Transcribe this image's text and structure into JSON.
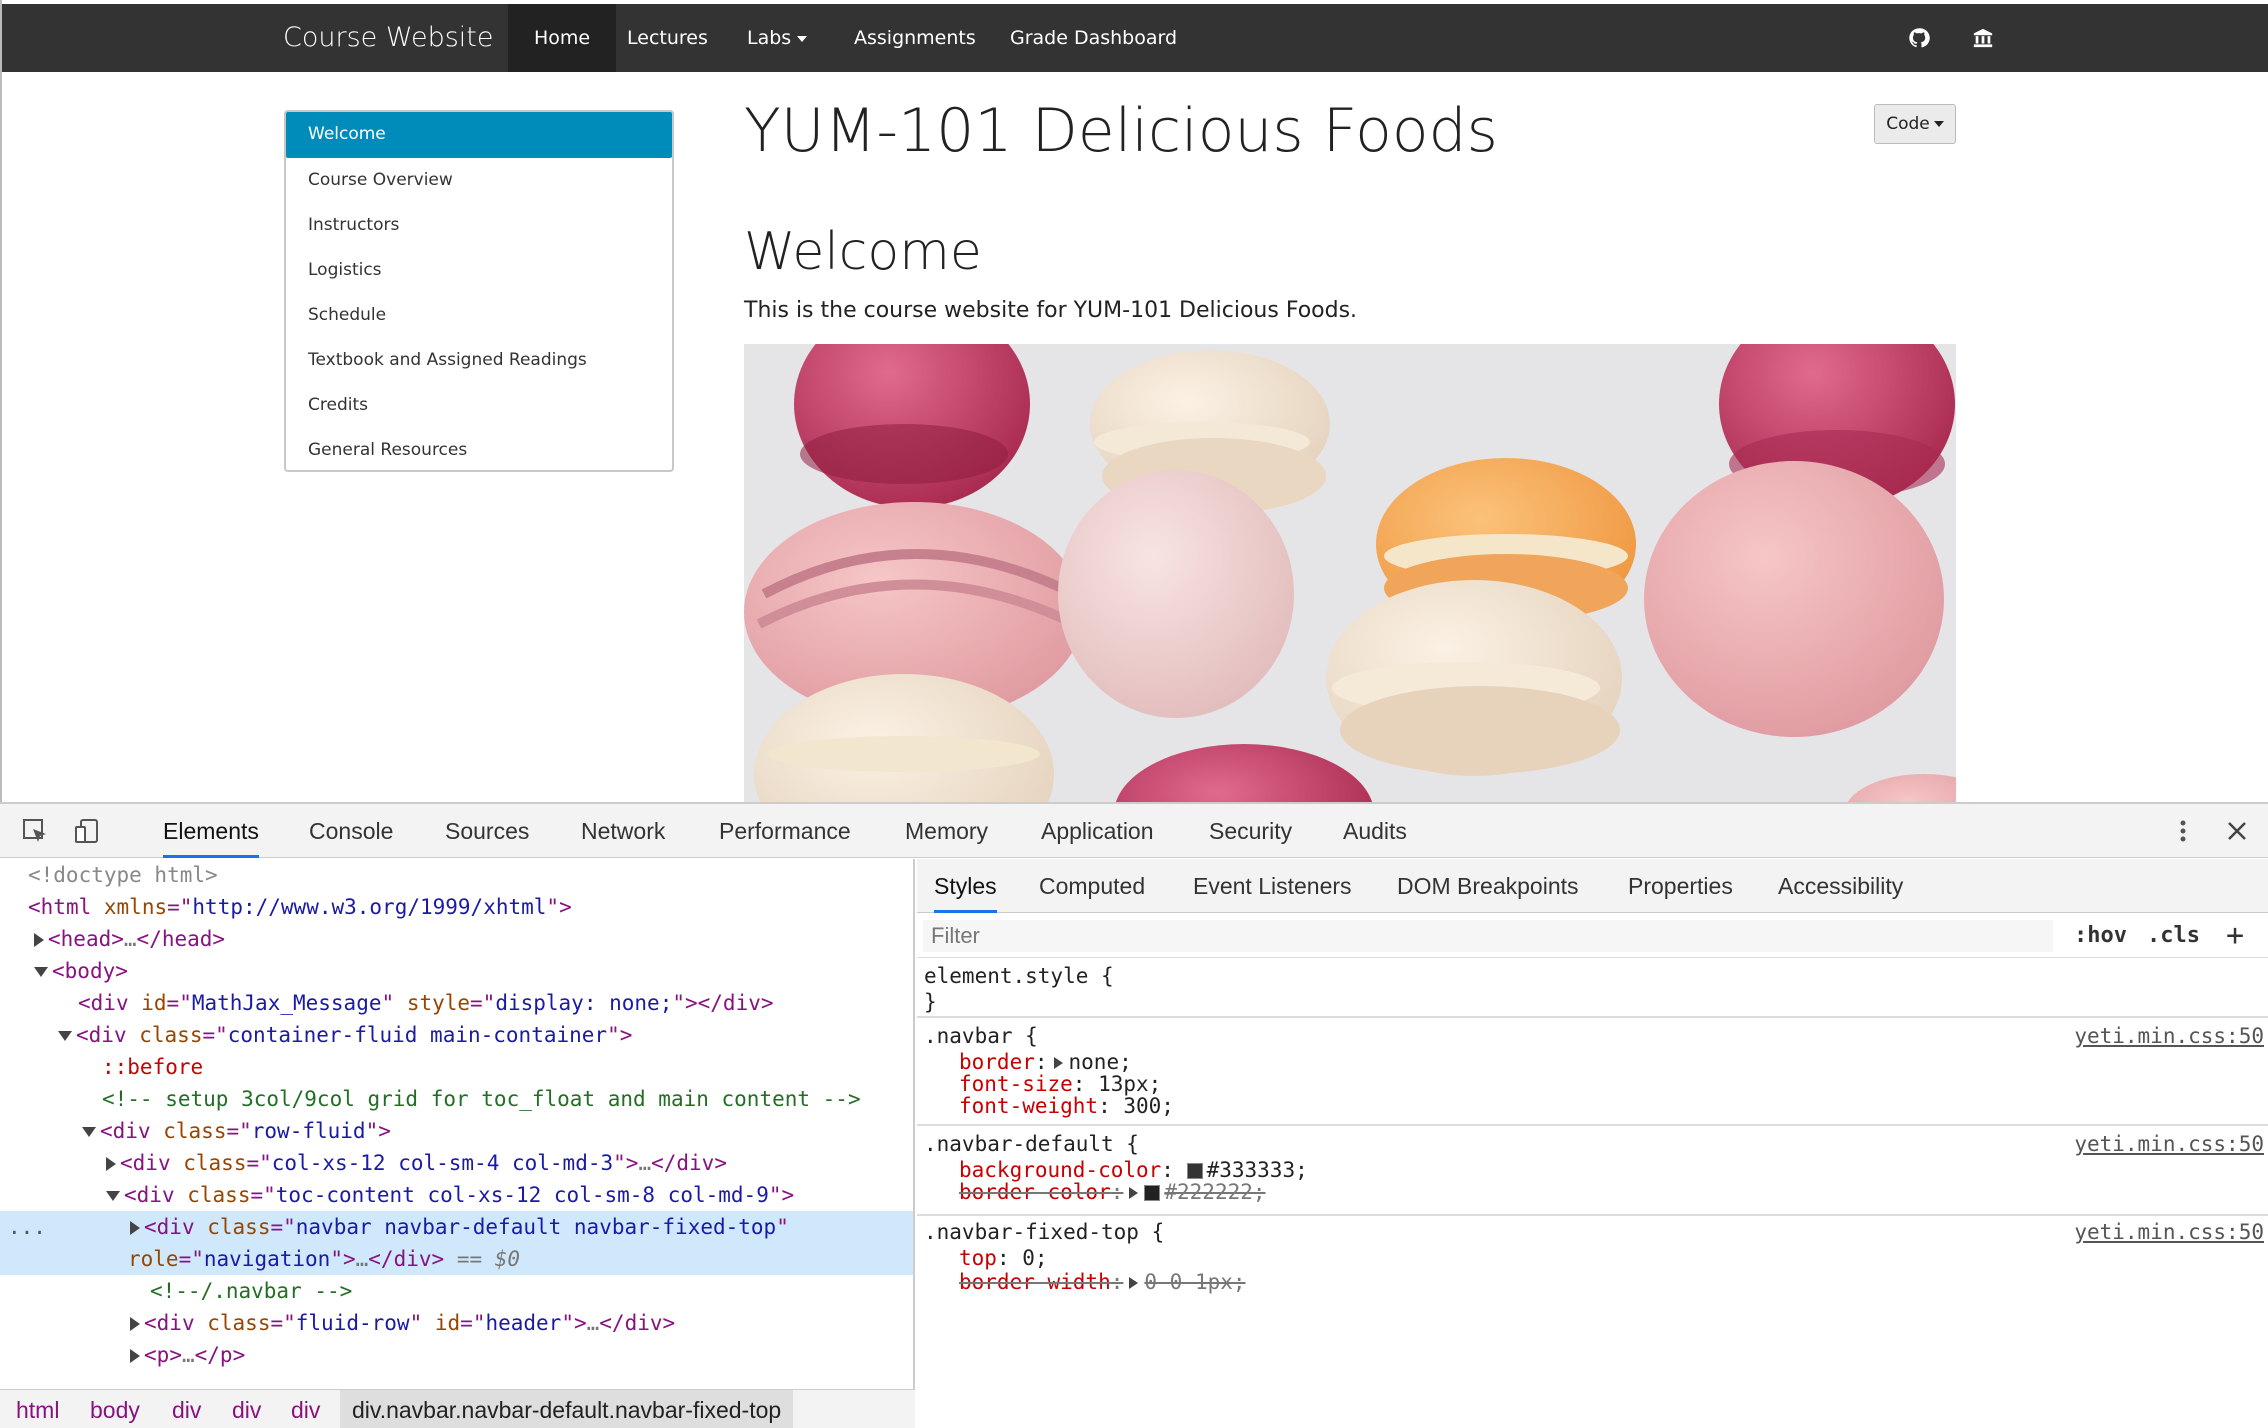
{
  "navbar": {
    "brand": "Course Website",
    "items": [
      {
        "label": "Home"
      },
      {
        "label": "Lectures"
      },
      {
        "label": "Labs"
      },
      {
        "label": "Assignments"
      },
      {
        "label": "Grade Dashboard"
      }
    ],
    "icons": [
      "github-icon",
      "university-icon"
    ],
    "active_color": "#222222",
    "bg_color": "#333333"
  },
  "toc": {
    "items": [
      {
        "label": "Welcome",
        "active": true
      },
      {
        "label": "Course Overview"
      },
      {
        "label": "Instructors"
      },
      {
        "label": "Logistics"
      },
      {
        "label": "Schedule"
      },
      {
        "label": "Textbook and Assigned Readings"
      },
      {
        "label": "Credits"
      },
      {
        "label": "General Resources"
      }
    ],
    "active_color": "#008cba"
  },
  "main": {
    "title": "YUM-101 Delicious Foods",
    "section_heading": "Welcome",
    "intro": "This is the course website for YUM-101 Delicious Foods.",
    "code_button": "Code"
  },
  "devtools": {
    "tabs": [
      "Elements",
      "Console",
      "Sources",
      "Network",
      "Performance",
      "Memory",
      "Application",
      "Security",
      "Audits"
    ],
    "active_tab": "Elements",
    "elements": {
      "doctype": "<!doctype html>",
      "html_tag": "html",
      "html_attr": "xmlns",
      "html_val": "http://www.w3.org/1999/xhtml",
      "head": "head",
      "body": "body",
      "mathjax": {
        "tag": "div",
        "a1": "id",
        "v1": "MathJax_Message",
        "a2": "style",
        "v2": "display: none;"
      },
      "container": {
        "tag": "div",
        "a1": "class",
        "v1": "container-fluid main-container"
      },
      "before": "::before",
      "comment": "<!-- setup 3col/9col grid for toc_float and main content  -->",
      "row": {
        "tag": "div",
        "a1": "class",
        "v1": "row-fluid"
      },
      "col1": {
        "tag": "div",
        "a1": "class",
        "v1": "col-xs-12 col-sm-4 col-md-3"
      },
      "col2": {
        "tag": "div",
        "a1": "class",
        "v1": "toc-content col-xs-12 col-sm-8 col-md-9"
      },
      "selected": {
        "tag": "div",
        "a1": "class",
        "v1": "navbar navbar-default  navbar-fixed-top",
        "a2": "role",
        "v2": "navigation",
        "suffix": "== $0"
      },
      "navbar_comment": "<!--/.navbar -->",
      "header": {
        "tag": "div",
        "a1": "class",
        "v1": "fluid-row",
        "a2": "id",
        "v2": "header"
      },
      "p_tag": "p",
      "ellipsis_marker": "..."
    },
    "breadcrumbs": [
      "html",
      "body",
      "div",
      "div",
      "div",
      "div.navbar.navbar-default.navbar-fixed-top"
    ],
    "styles_tabs": [
      "Styles",
      "Computed",
      "Event Listeners",
      "DOM Breakpoints",
      "Properties",
      "Accessibility"
    ],
    "filter_placeholder": "Filter",
    "hov": ":hov",
    "cls": ".cls",
    "add": "+",
    "rules": [
      {
        "selector": "element.style",
        "source": "",
        "decls": []
      },
      {
        "selector": ".navbar",
        "source": "yeti.min.css:50",
        "decls": [
          {
            "prop": "border",
            "value": "none;",
            "expand": true
          },
          {
            "prop": "font-size",
            "value": "13px;"
          },
          {
            "prop": "font-weight",
            "value": "300;"
          }
        ]
      },
      {
        "selector": ".navbar-default",
        "source": "yeti.min.css:50",
        "decls": [
          {
            "prop": "background-color",
            "value": "#333333;",
            "swatch": "#333333"
          },
          {
            "prop": "border-color",
            "value": "#222222;",
            "swatch": "#222222",
            "expand": true,
            "struck": true
          }
        ]
      },
      {
        "selector": ".navbar-fixed-top",
        "source": "yeti.min.css:50",
        "decls": [
          {
            "prop": "top",
            "value": "0;"
          },
          {
            "prop": "border-width",
            "value": "0 0 1px;",
            "expand": true,
            "struck": true
          }
        ]
      }
    ]
  }
}
